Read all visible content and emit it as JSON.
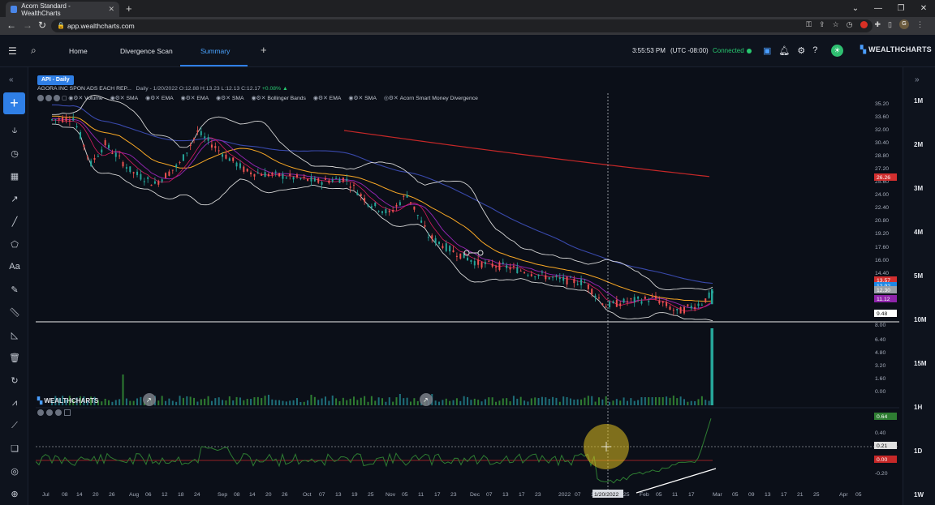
{
  "browser": {
    "tab_title": "Acorn Standard - WealthCharts",
    "url": "app.wealthcharts.com"
  },
  "header": {
    "nav": [
      "Home",
      "Divergence Scan",
      "Summary"
    ],
    "active_nav": "Summary",
    "time": "3:55:53 PM",
    "timezone": "(UTC -08:00)",
    "connection": "Connected",
    "brand": "WEALTHCHARTS"
  },
  "chart": {
    "symbol_badge": "API - Daily",
    "name": "AGORA INC SPON ADS EACH REP...",
    "quote": "Daily - 1/20/2022 O:12.88 H:13.23 L:12.13 C:12.17",
    "change": "+0.08% ▲",
    "indicators": [
      "Volume",
      "SMA",
      "EMA",
      "EMA",
      "SMA",
      "Bollinger Bands",
      "EMA",
      "SMA",
      "Acorn Smart Money Divergence"
    ],
    "watermark": "WEALTHCHARTS",
    "crosshair_date": "1/20/2022"
  },
  "price_axis": [
    "35.20",
    "33.60",
    "32.00",
    "30.40",
    "28.80",
    "27.20",
    "25.60",
    "24.00",
    "22.40",
    "20.80",
    "19.20",
    "17.60",
    "16.00",
    "14.40",
    "8.00"
  ],
  "price_tags": [
    {
      "value": "26.26",
      "color": "#d32f2f"
    },
    {
      "value": "13.57",
      "color": "#d32f2f"
    },
    {
      "value": "12.92",
      "color": "#1e88e5"
    },
    {
      "value": "12.30",
      "color": "#9aa0a6"
    },
    {
      "value": "11.12",
      "color": "#8e24aa"
    },
    {
      "value": "9.48",
      "color": "#ffffff"
    }
  ],
  "volume_axis": [
    "6.40",
    "4.80",
    "3.20",
    "1.60",
    "0.00"
  ],
  "osc_axis": [
    "0.40",
    "0.20",
    "0.00",
    "-0.20"
  ],
  "osc_tags": [
    {
      "value": "0.64",
      "color": "#2e7d32"
    },
    {
      "value": "0.21",
      "color": "#e0e0e0"
    },
    {
      "value": "0.00",
      "color": "#c62828"
    }
  ],
  "time_axis": [
    "Jul",
    "08",
    "14",
    "20",
    "26",
    "Aug",
    "06",
    "12",
    "18",
    "24",
    "Sep",
    "08",
    "14",
    "20",
    "26",
    "Oct",
    "07",
    "13",
    "19",
    "25",
    "Nov",
    "05",
    "11",
    "17",
    "23",
    "Dec",
    "07",
    "13",
    "17",
    "23",
    "2022",
    "07",
    "13",
    "19",
    "25",
    "Feb",
    "05",
    "11",
    "17",
    "Mar",
    "05",
    "09",
    "13",
    "17",
    "21",
    "25",
    "Apr",
    "05"
  ],
  "right_panel": {
    "timeframes": [
      "1M",
      "2M",
      "3M",
      "4M",
      "5M",
      "10M",
      "15M",
      "1H",
      "1D",
      "1W"
    ]
  },
  "colors": {
    "accent": "#2f7fe6",
    "up": "#26a69a",
    "down": "#ef5350",
    "connected": "#28c76f"
  }
}
